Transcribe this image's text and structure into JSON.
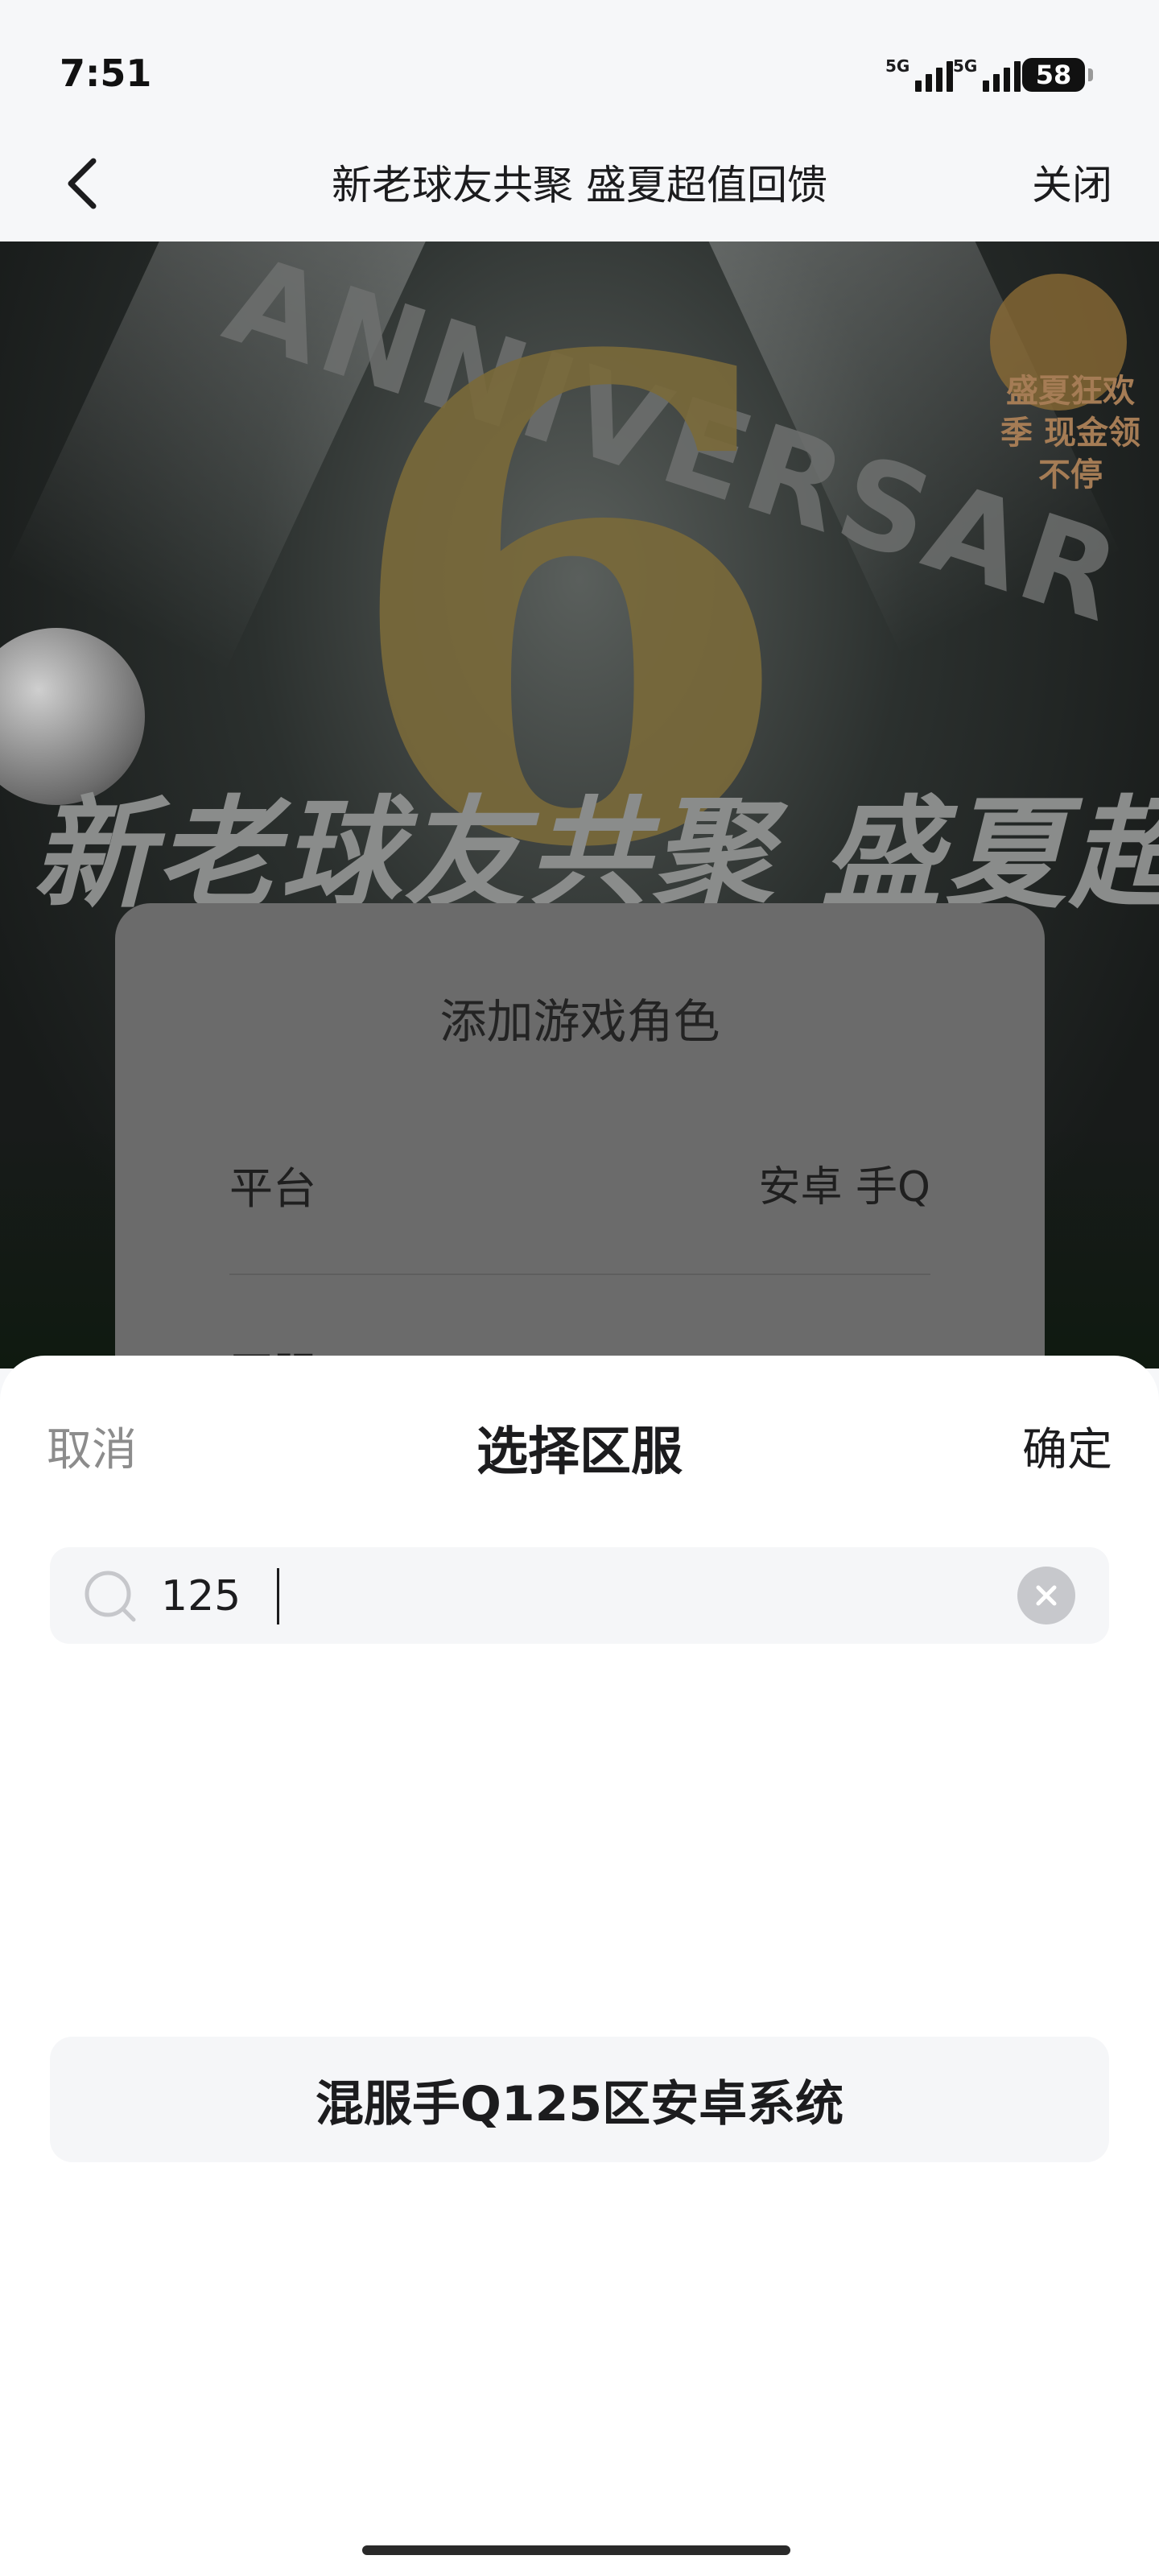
{
  "status_bar": {
    "time": "7:51",
    "signal1_label": "5G",
    "signal2_label": "5G",
    "battery": "58"
  },
  "nav": {
    "back_icon": "chevron-left-icon",
    "title": "新老球友共聚 盛夏超值回馈",
    "close_label": "关闭"
  },
  "hero": {
    "anniversary_text": "ANNIVERSAR",
    "number": "6",
    "slogan": "新老球友共聚 盛夏超值回馈",
    "badge_text": "盛夏狂欢季 现金领不停"
  },
  "dialog": {
    "title": "添加游戏角色",
    "platform_label": "平台",
    "platform_value": "安卓 手Q",
    "server_label": "区服"
  },
  "sheet": {
    "cancel_label": "取消",
    "title": "选择区服",
    "confirm_label": "确定",
    "search": {
      "value": "125",
      "placeholder": "",
      "search_icon": "search-icon",
      "clear_icon": "clear-icon"
    },
    "results": [
      "混服手Q125区安卓系统"
    ]
  },
  "colors": {
    "sheet_bg": "#ffffff",
    "field_bg": "#f5f6f8",
    "muted_text": "#8c8c8c",
    "primary_text": "#1c1c1e"
  }
}
